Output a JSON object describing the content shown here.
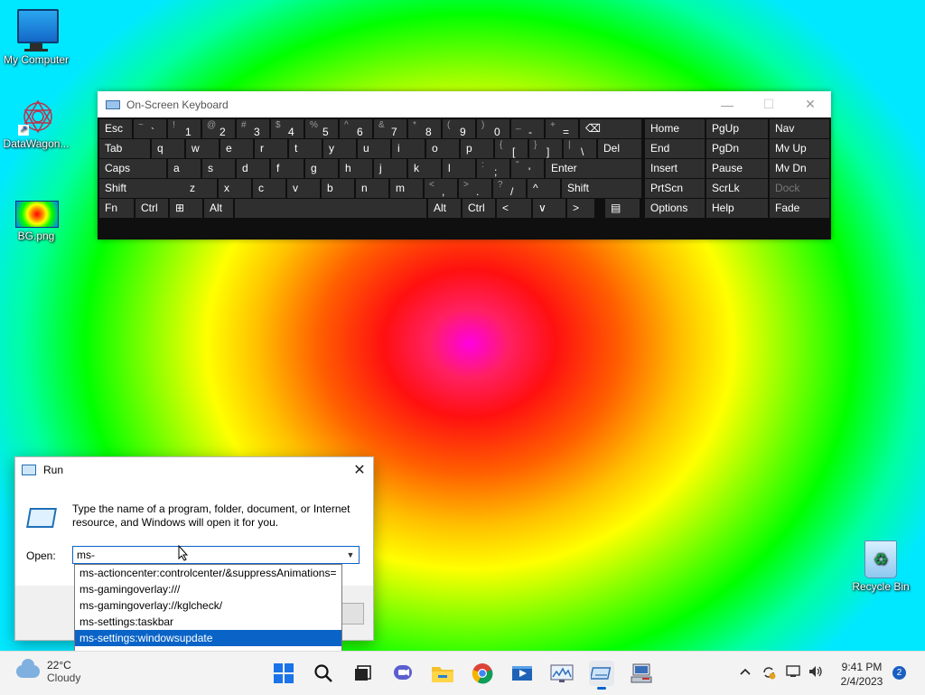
{
  "desktop": {
    "icons": [
      {
        "label": "My Computer",
        "icon": "monitor-icon"
      },
      {
        "label": "DataWagon...",
        "icon": "datawagon-icon"
      },
      {
        "label": "BG.png",
        "icon": "image-file-icon"
      },
      {
        "label": "Recycle Bin",
        "icon": "recycle-bin-icon"
      }
    ]
  },
  "osk": {
    "title": "On-Screen Keyboard",
    "minimize": "—",
    "maximize": "☐",
    "close": "✕",
    "row1": [
      {
        "label": "Esc"
      },
      {
        "shift": "~",
        "main": "`"
      },
      {
        "shift": "!",
        "main": "1"
      },
      {
        "shift": "@",
        "main": "2"
      },
      {
        "shift": "#",
        "main": "3"
      },
      {
        "shift": "$",
        "main": "4"
      },
      {
        "shift": "%",
        "main": "5"
      },
      {
        "shift": "^",
        "main": "6"
      },
      {
        "shift": "&",
        "main": "7"
      },
      {
        "shift": "*",
        "main": "8"
      },
      {
        "shift": "(",
        "main": "9"
      },
      {
        "shift": ")",
        "main": "0"
      },
      {
        "shift": "_",
        "main": "-"
      },
      {
        "shift": "+",
        "main": "="
      },
      {
        "label": "⌫"
      }
    ],
    "row2": [
      {
        "label": "Tab"
      },
      {
        "label": "q"
      },
      {
        "label": "w"
      },
      {
        "label": "e"
      },
      {
        "label": "r"
      },
      {
        "label": "t"
      },
      {
        "label": "y"
      },
      {
        "label": "u"
      },
      {
        "label": "i"
      },
      {
        "label": "o"
      },
      {
        "label": "p"
      },
      {
        "shift": "{",
        "main": "["
      },
      {
        "shift": "}",
        "main": "]"
      },
      {
        "shift": "|",
        "main": "\\"
      },
      {
        "label": "Del"
      }
    ],
    "row3": [
      {
        "label": "Caps"
      },
      {
        "label": "a"
      },
      {
        "label": "s"
      },
      {
        "label": "d"
      },
      {
        "label": "f"
      },
      {
        "label": "g"
      },
      {
        "label": "h"
      },
      {
        "label": "j"
      },
      {
        "label": "k"
      },
      {
        "label": "l"
      },
      {
        "shift": ":",
        "main": ";"
      },
      {
        "shift": "\"",
        "main": "'"
      },
      {
        "label": "Enter"
      }
    ],
    "row4": [
      {
        "label": "Shift"
      },
      {
        "label": "z"
      },
      {
        "label": "x"
      },
      {
        "label": "c"
      },
      {
        "label": "v"
      },
      {
        "label": "b"
      },
      {
        "label": "n"
      },
      {
        "label": "m"
      },
      {
        "shift": "<",
        "main": ","
      },
      {
        "shift": ">",
        "main": "."
      },
      {
        "shift": "?",
        "main": "/"
      },
      {
        "label": "^"
      },
      {
        "label": "Shift"
      }
    ],
    "row5": [
      {
        "label": "Fn"
      },
      {
        "label": "Ctrl"
      },
      {
        "label": "⊞"
      },
      {
        "label": "Alt"
      },
      {
        "label": ""
      },
      {
        "label": "Alt"
      },
      {
        "label": "Ctrl"
      },
      {
        "label": "<"
      },
      {
        "label": "∨"
      },
      {
        "label": ">"
      },
      {
        "label": "▤"
      }
    ],
    "nav": [
      [
        "Home",
        "PgUp",
        "Nav"
      ],
      [
        "End",
        "PgDn",
        "Mv Up"
      ],
      [
        "Insert",
        "Pause",
        "Mv Dn"
      ],
      [
        "PrtScn",
        "ScrLk",
        "Dock"
      ],
      [
        "Options",
        "Help",
        "Fade"
      ]
    ]
  },
  "run": {
    "title": "Run",
    "close": "✕",
    "description": "Type the name of a program, folder, document, or Internet resource, and Windows will open it for you.",
    "open_label": "Open:",
    "input_value": "ms-",
    "suggestions": [
      "ms-actioncenter:controlcenter/&suppressAnimations=",
      "ms-gamingoverlay:///",
      "ms-gamingoverlay://kglcheck/",
      "ms-settings:taskbar",
      "ms-settings:windowsupdate"
    ],
    "selected_suggestion": 4
  },
  "taskbar": {
    "weather_temp": "22°C",
    "weather_desc": "Cloudy",
    "apps": [
      "start-icon",
      "search-icon",
      "task-view-icon",
      "chat-icon",
      "file-explorer-icon",
      "chrome-icon",
      "media-icon",
      "monitor-app-icon",
      "on-screen-keyboard-icon",
      "network-tool-icon"
    ],
    "time": "9:41 PM",
    "date": "2/4/2023",
    "notifications": "2"
  }
}
